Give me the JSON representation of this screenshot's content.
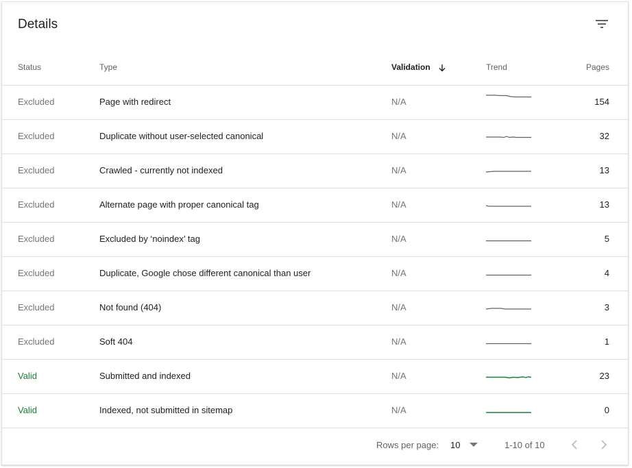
{
  "header": {
    "title": "Details"
  },
  "columns": {
    "status": "Status",
    "type": "Type",
    "validation": "Validation",
    "trend": "Trend",
    "pages": "Pages"
  },
  "colors": {
    "excluded_text": "#757575",
    "valid_text": "#188038",
    "trend_excluded": "#5f6368",
    "trend_valid": "#188038"
  },
  "rows": [
    {
      "status": "Excluded",
      "type": "Page with redirect",
      "validation": "N/A",
      "pages": "154",
      "trend_kind": "excluded"
    },
    {
      "status": "Excluded",
      "type": "Duplicate without user-selected canonical",
      "validation": "N/A",
      "pages": "32",
      "trend_kind": "excluded"
    },
    {
      "status": "Excluded",
      "type": "Crawled - currently not indexed",
      "validation": "N/A",
      "pages": "13",
      "trend_kind": "excluded"
    },
    {
      "status": "Excluded",
      "type": "Alternate page with proper canonical tag",
      "validation": "N/A",
      "pages": "13",
      "trend_kind": "excluded"
    },
    {
      "status": "Excluded",
      "type": "Excluded by ‘noindex’ tag",
      "validation": "N/A",
      "pages": "5",
      "trend_kind": "excluded"
    },
    {
      "status": "Excluded",
      "type": "Duplicate, Google chose different canonical than user",
      "validation": "N/A",
      "pages": "4",
      "trend_kind": "excluded"
    },
    {
      "status": "Excluded",
      "type": "Not found (404)",
      "validation": "N/A",
      "pages": "3",
      "trend_kind": "excluded"
    },
    {
      "status": "Excluded",
      "type": "Soft 404",
      "validation": "N/A",
      "pages": "1",
      "trend_kind": "excluded"
    },
    {
      "status": "Valid",
      "type": "Submitted and indexed",
      "validation": "N/A",
      "pages": "23",
      "trend_kind": "valid"
    },
    {
      "status": "Valid",
      "type": "Indexed, not submitted in sitemap",
      "validation": "N/A",
      "pages": "0",
      "trend_kind": "valid"
    }
  ],
  "footer": {
    "rows_per_page_label": "Rows per page:",
    "rows_per_page_value": "10",
    "range_text": "1-10 of 10"
  },
  "icons": {
    "filter": "filter-icon",
    "sort": "arrow-down-icon",
    "dropdown": "dropdown-arrow-icon",
    "prev": "chevron-left-icon",
    "next": "chevron-right-icon"
  }
}
